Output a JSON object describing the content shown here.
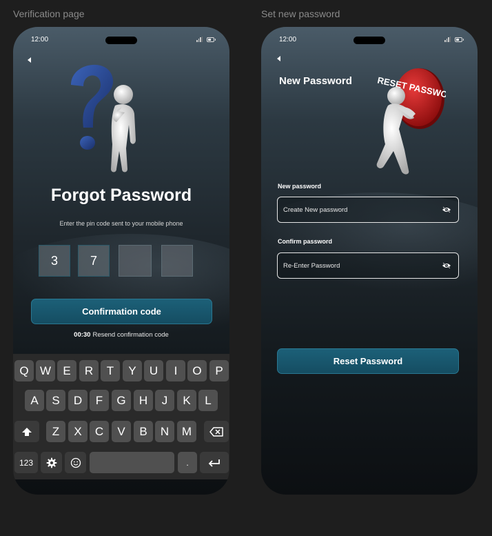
{
  "frames": {
    "verification_label": "Verification page",
    "set_password_label": "Set new password"
  },
  "status_bar": {
    "time": "12:00"
  },
  "verification": {
    "title": "Forgot Password",
    "subtitle": "Enter the pin code sent to your mobile phone",
    "pin_digits": [
      "3",
      "7",
      "",
      ""
    ],
    "confirm_button": "Confirmation code",
    "timer": "00:30",
    "resend_text": "Resend confirmation code",
    "illustration": "question-mark-figure"
  },
  "keyboard": {
    "row1": [
      "Q",
      "W",
      "E",
      "R",
      "T",
      "Y",
      "U",
      "I",
      "O",
      "P"
    ],
    "row2": [
      "A",
      "S",
      "D",
      "F",
      "G",
      "H",
      "J",
      "K",
      "L"
    ],
    "row3": [
      "Z",
      "X",
      "C",
      "V",
      "B",
      "N",
      "M"
    ],
    "numbers_key": "123",
    "period_key": ".",
    "icons": {
      "shift": "shift-icon",
      "backspace": "backspace-icon",
      "settings": "gear-icon",
      "emoji": "emoji-icon",
      "return": "return-icon"
    }
  },
  "set_password": {
    "title": "New Password",
    "illustration": "reset-password-button-figure",
    "illustration_text": "RESET PASSWORD",
    "new_password_label": "New password",
    "new_password_placeholder": "Create New password",
    "confirm_password_label": "Confirm password",
    "confirm_password_placeholder": "Re-Enter Password",
    "reset_button": "Reset Password"
  },
  "colors": {
    "accent": "#1a5a72",
    "background": "#1e1e1e"
  }
}
